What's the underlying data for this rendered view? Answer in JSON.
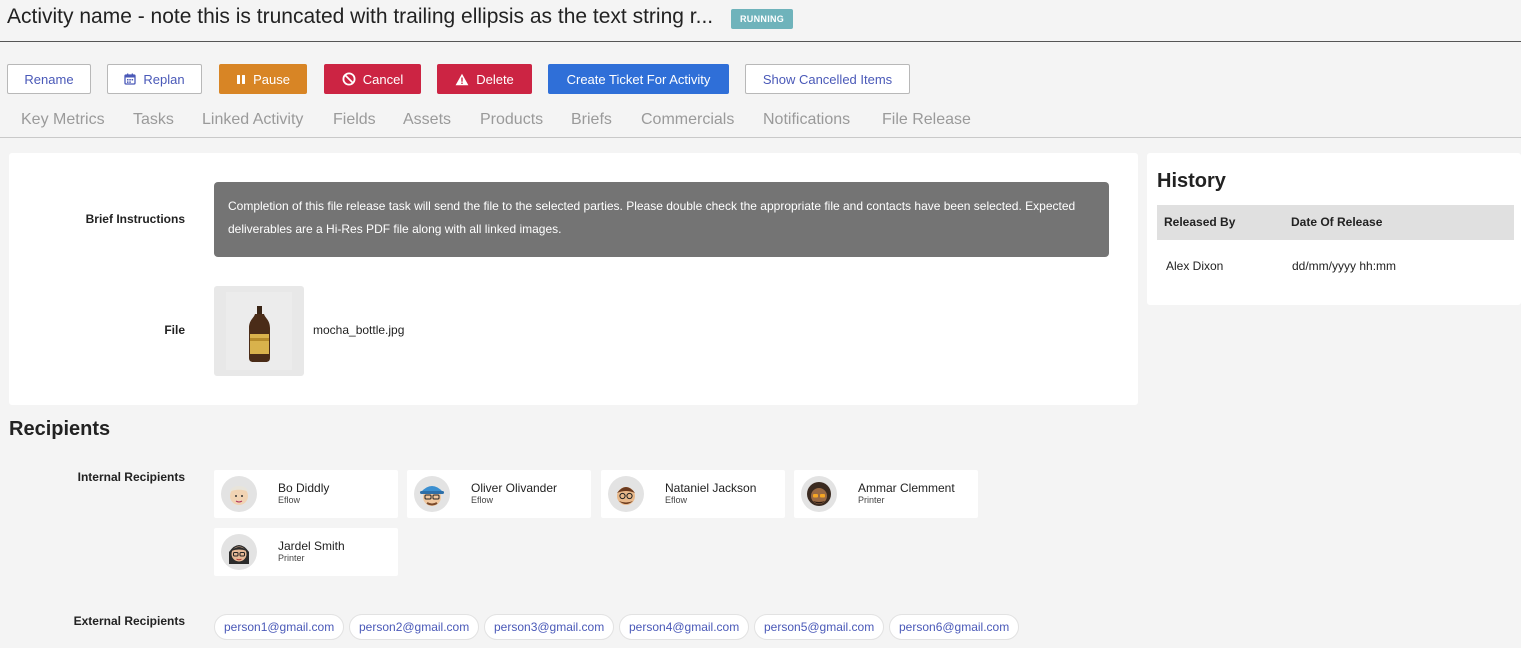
{
  "header": {
    "title": "Activity name - note this is truncated with trailing ellipsis as the text string r...",
    "status": "RUNNING"
  },
  "toolbar": {
    "rename": "Rename",
    "replan": "Replan",
    "pause": "Pause",
    "cancel": "Cancel",
    "delete": "Delete",
    "create_ticket": "Create Ticket For Activity",
    "show_cancelled": "Show Cancelled Items"
  },
  "tabs": [
    "Key Metrics",
    "Tasks",
    "Linked Activity",
    "Fields",
    "Assets",
    "Products",
    "Briefs",
    "Commercials",
    "Notifications",
    "File Release"
  ],
  "main": {
    "brief_label": "Brief Instructions",
    "brief_text": "Completion of this file release task will send the file to the selected parties. Please double check the appropriate file and contacts have been selected. Expected deliverables are a Hi-Res PDF file along with all linked images.",
    "file_label": "File",
    "file_name": "mocha_bottle.jpg"
  },
  "history": {
    "title": "History",
    "col_released_by": "Released By",
    "col_date": "Date Of Release",
    "rows": [
      {
        "released_by": "Alex Dixon",
        "date": "dd/mm/yyyy hh:mm"
      }
    ]
  },
  "recipients": {
    "title": "Recipients",
    "internal_label": "Internal Recipients",
    "internal": [
      {
        "name": "Bo Diddly",
        "org": "Eflow"
      },
      {
        "name": "Oliver Olivander",
        "org": "Eflow"
      },
      {
        "name": "Nataniel Jackson",
        "org": "Eflow"
      },
      {
        "name": "Ammar Clemment",
        "org": "Printer"
      },
      {
        "name": "Jardel Smith",
        "org": "Printer"
      }
    ],
    "external_label": "External Recipients",
    "external": [
      "person1@gmail.com",
      "person2@gmail.com",
      "person3@gmail.com",
      "person4@gmail.com",
      "person5@gmail.com",
      "person6@gmail.com"
    ]
  },
  "colors": {
    "status_badge": "#6fb3bb",
    "pause": "#d88525",
    "danger": "#cc2443",
    "primary": "#2f6fd8",
    "link": "#4a59b8"
  }
}
